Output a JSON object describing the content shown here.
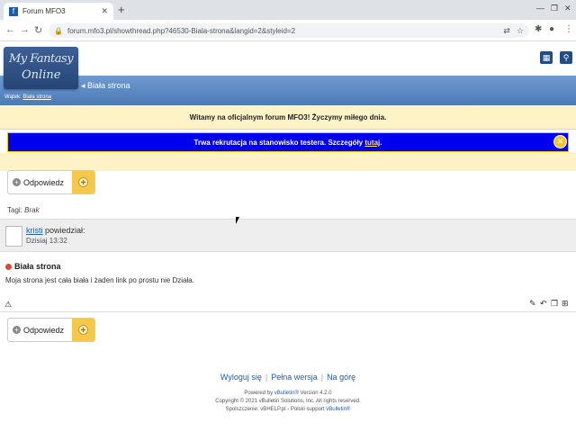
{
  "browser": {
    "tab_title": "Forum MFO3",
    "tab_icon": "forum-favicon",
    "url": "forum.mfo3.pl/showthread.php?46530-Biala-strona&langid=2&styleid=2"
  },
  "site": {
    "logo_line1": "My Fantasy",
    "logo_line2": "Online",
    "crumb_title": "Biała strona",
    "crumb_prefix": "Wątek:",
    "crumb_link": "Biała strona"
  },
  "welcome": "Witamy na oficjalnym forum MFO3! Życzymy miłego dnia.",
  "notice": {
    "text": "Trwa rekrutacja na stanowisko testera. Szczegóły",
    "link": "tutaj",
    "after": "."
  },
  "reply": {
    "label": "Odpowiedz"
  },
  "tags": {
    "label": "Tagi:",
    "value": "Brak"
  },
  "post": {
    "author": "kristi",
    "said": "powiedział:",
    "date": "Dzisiaj 13:32",
    "title": "Biała strona",
    "body": "Moja strona jest cała biała i żaden link po prostu nie Działa."
  },
  "footer": {
    "links": [
      "Wyloguj się",
      "Pełna wersja",
      "Na górę"
    ],
    "powered_prefix": "Powered by",
    "powered_link": "vBulletin®",
    "powered_suffix": "Version 4.2.0",
    "copyright": "Copyright © 2021 vBulletin Solutions, Inc. All rights reserved.",
    "translation_prefix": "Spolszczenie: vBHELP.pl - Polski support",
    "translation_link": "vBulletin®"
  },
  "colors": {
    "notice_bg": "#0000ee",
    "welcome_bg": "#fdf3c7",
    "header_bar": "#5a87c0",
    "link": "#1b5ea8"
  }
}
